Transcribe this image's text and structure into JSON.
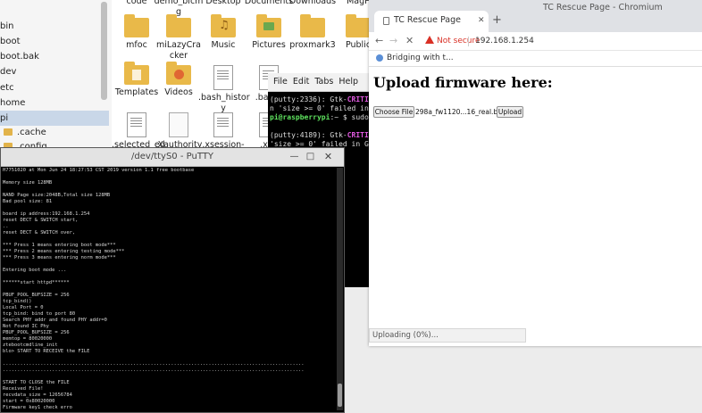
{
  "file_manager": {
    "tree_items": [
      {
        "label": "bin",
        "selected": false
      },
      {
        "label": "boot",
        "selected": false
      },
      {
        "label": "boot.bak",
        "selected": false
      },
      {
        "label": "dev",
        "selected": false
      },
      {
        "label": "etc",
        "selected": false
      },
      {
        "label": "home",
        "selected": false
      },
      {
        "label": "pi",
        "selected": true
      },
      {
        "label": ".cache",
        "selected": false
      },
      {
        "label": ".config",
        "selected": false
      }
    ],
    "items": [
      {
        "label": "code",
        "icon": "folder"
      },
      {
        "label": "demo_bicm g",
        "icon": "folder"
      },
      {
        "label": "Desktop",
        "icon": "folder"
      },
      {
        "label": "Documents",
        "icon": "folder"
      },
      {
        "label": "Downloads",
        "icon": "folder"
      },
      {
        "label": "MagP",
        "icon": "folder"
      },
      {
        "label": "mfoc",
        "icon": "folder"
      },
      {
        "label": "miLazyCra cker",
        "icon": "folder"
      },
      {
        "label": "Music",
        "icon": "music-folder"
      },
      {
        "label": "Pictures",
        "icon": "pictures-folder"
      },
      {
        "label": "proxmark3",
        "icon": "folder"
      },
      {
        "label": "Public",
        "icon": "folder"
      },
      {
        "label": "Templates",
        "icon": "templates-folder"
      },
      {
        "label": "Videos",
        "icon": "videos-folder"
      },
      {
        "label": ".bash_histor y",
        "icon": "text-file"
      },
      {
        "label": ".bash_",
        "icon": "text-file"
      },
      {
        "label": ".selected_ed",
        "icon": "text-file"
      },
      {
        "label": ".Xauthority",
        "icon": "blank-file"
      },
      {
        "label": ".xsession-",
        "icon": "text-file"
      },
      {
        "label": ".xse",
        "icon": "text-file"
      }
    ]
  },
  "terminal_back": {
    "menu": [
      "File",
      "Edit",
      "Tabs",
      "Help"
    ],
    "lines": [
      {
        "parts": [
          {
            "t": "(putty:2336): Gtk-",
            "c": ""
          },
          {
            "t": "CRITICAL",
            "c": "mag"
          }
        ]
      },
      {
        "parts": [
          {
            "t": "n 'size >= 0' failed in Gt",
            "c": ""
          }
        ]
      },
      {
        "parts": [
          {
            "t": "pi@raspberrypi",
            "c": "grn"
          },
          {
            "t": ":~ $ sudo pu",
            "c": ""
          }
        ]
      },
      {
        "parts": [
          {
            "t": "",
            "c": ""
          }
        ]
      },
      {
        "parts": [
          {
            "t": "(putty:4189): Gtk-",
            "c": ""
          },
          {
            "t": "CRITICAL",
            "c": "mag"
          }
        ]
      },
      {
        "parts": [
          {
            "t": "'size >= 0' failed in Gt",
            "c": ""
          }
        ]
      }
    ]
  },
  "putty": {
    "title": "/dev/ttyS0 - PuTTY",
    "lines": [
      "H7751020 at Mon Jun 24 18:27:53 CST 2019 version 1.1 free bootbase",
      "",
      "Memory size 128MB",
      "",
      "NAND Page size:2048B,Total size 128MB",
      "Bad pool size: 81",
      "",
      "board ip address:192.168.1.254",
      "reset DECT & SWITCH start,",
      "..",
      "reset DECT & SWITCH over,",
      "",
      "*** Press 1 means entering boot mode***",
      "*** Press 2 means entering testing mode***",
      "*** Press 3 means entering norm mode***",
      "",
      "Entering boot mode ...",
      "",
      "******start httpd******",
      "",
      "PBUF_POOL_BUFSIZE = 256",
      "tcp_bind()",
      "Local Port = 0",
      "tcp_bind: bind to port 80",
      "Search PHY addr and found PHY addr=0",
      "Not Found IC Phy",
      "PBUF_POOL_BUFSIZE = 256",
      "memtop = 80020000",
      "ztebootcmdline_init",
      "blo> START TO RECEIVE the FILE",
      "",
      "........................................................................................................",
      "........................................................................................................",
      "",
      "START TO CLOSE the FILE",
      "Received File!",
      "recvdata_size = 12656784",
      "start = 0x80020000",
      "Firmware key1 check erro"
    ]
  },
  "browser": {
    "window_title": "TC Rescue Page - Chromium",
    "tab_title": "TC Rescue Page",
    "security_label": "Not secure",
    "url": "192.168.1.254",
    "bookmark": "Bridging with t...",
    "heading": "Upload firmware here:",
    "choose_file_label": "Choose File",
    "file_name": "298a_fw1120...16_real.bin",
    "upload_label": "Upload",
    "status": "Uploading (0%)..."
  }
}
